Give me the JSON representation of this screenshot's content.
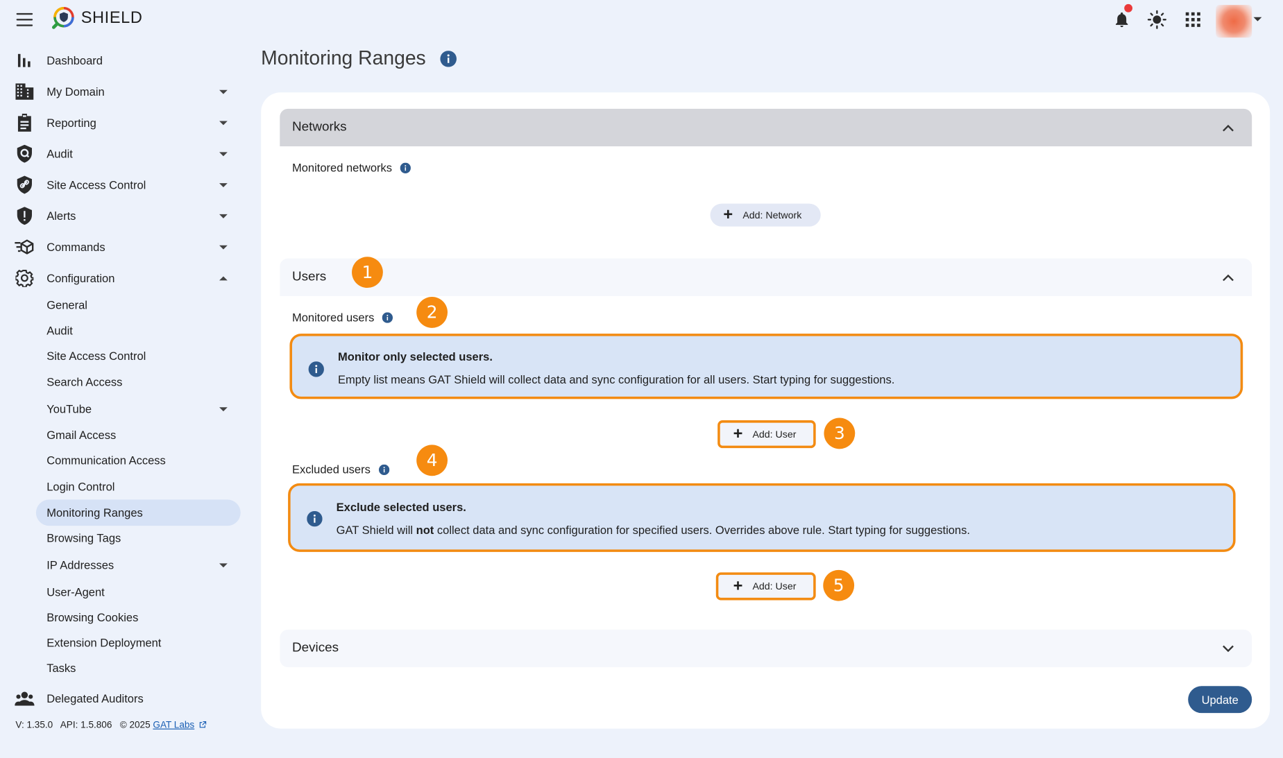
{
  "app": {
    "title": "SHIELD"
  },
  "colors": {
    "accent": "#2f5b8e",
    "highlight": "#f38b12",
    "step_badge": "#f68b10",
    "notification_dot": "#ea3a3a"
  },
  "sidebar": {
    "items": [
      {
        "label": "Dashboard",
        "icon": "bar-chart-icon"
      },
      {
        "label": "My Domain",
        "icon": "building-icon"
      },
      {
        "label": "Reporting",
        "icon": "clipboard-icon"
      },
      {
        "label": "Audit",
        "icon": "shield-search-icon"
      },
      {
        "label": "Site Access Control",
        "icon": "shield-link-icon"
      },
      {
        "label": "Alerts",
        "icon": "shield-alert-icon"
      },
      {
        "label": "Commands",
        "icon": "commands-icon"
      },
      {
        "label": "Configuration",
        "icon": "gear-icon"
      }
    ],
    "config_sub": [
      {
        "label": "General"
      },
      {
        "label": "Audit"
      },
      {
        "label": "Site Access Control"
      },
      {
        "label": "Search Access"
      },
      {
        "label": "YouTube"
      },
      {
        "label": "Gmail Access"
      },
      {
        "label": "Communication Access"
      },
      {
        "label": "Login Control"
      },
      {
        "label": "Monitoring Ranges"
      },
      {
        "label": "Browsing Tags"
      },
      {
        "label": "IP Addresses"
      },
      {
        "label": "User-Agent"
      },
      {
        "label": "Browsing Cookies"
      },
      {
        "label": "Extension Deployment"
      },
      {
        "label": "Tasks"
      }
    ],
    "delegated": {
      "label": "Delegated Auditors",
      "icon": "people-icon"
    },
    "footer": {
      "version": "V: 1.35.0",
      "api": "API: 1.5.806",
      "copyright": "© 2025",
      "link": "GAT Labs"
    }
  },
  "main": {
    "title": "Monitoring Ranges",
    "networks": {
      "header": "Networks",
      "monitored_label": "Monitored networks",
      "add_label": "Add: Network"
    },
    "users": {
      "header": "Users",
      "monitored_label": "Monitored users",
      "monitored_info_title": "Monitor only selected users.",
      "monitored_info_text": "Empty list means GAT Shield will collect data and sync configuration for all users. Start typing for suggestions.",
      "add_label": "Add: User",
      "excluded_label": "Excluded users",
      "excluded_info_title": "Exclude selected users.",
      "excluded_info_pre": "GAT Shield will ",
      "excluded_info_bold": "not",
      "excluded_info_post": " collect data and sync configuration for specified users. Overrides above rule. Start typing for suggestions.",
      "add_label_2": "Add: User"
    },
    "devices": {
      "header": "Devices"
    },
    "update_label": "Update",
    "steps": [
      "1",
      "2",
      "3",
      "4",
      "5"
    ]
  }
}
